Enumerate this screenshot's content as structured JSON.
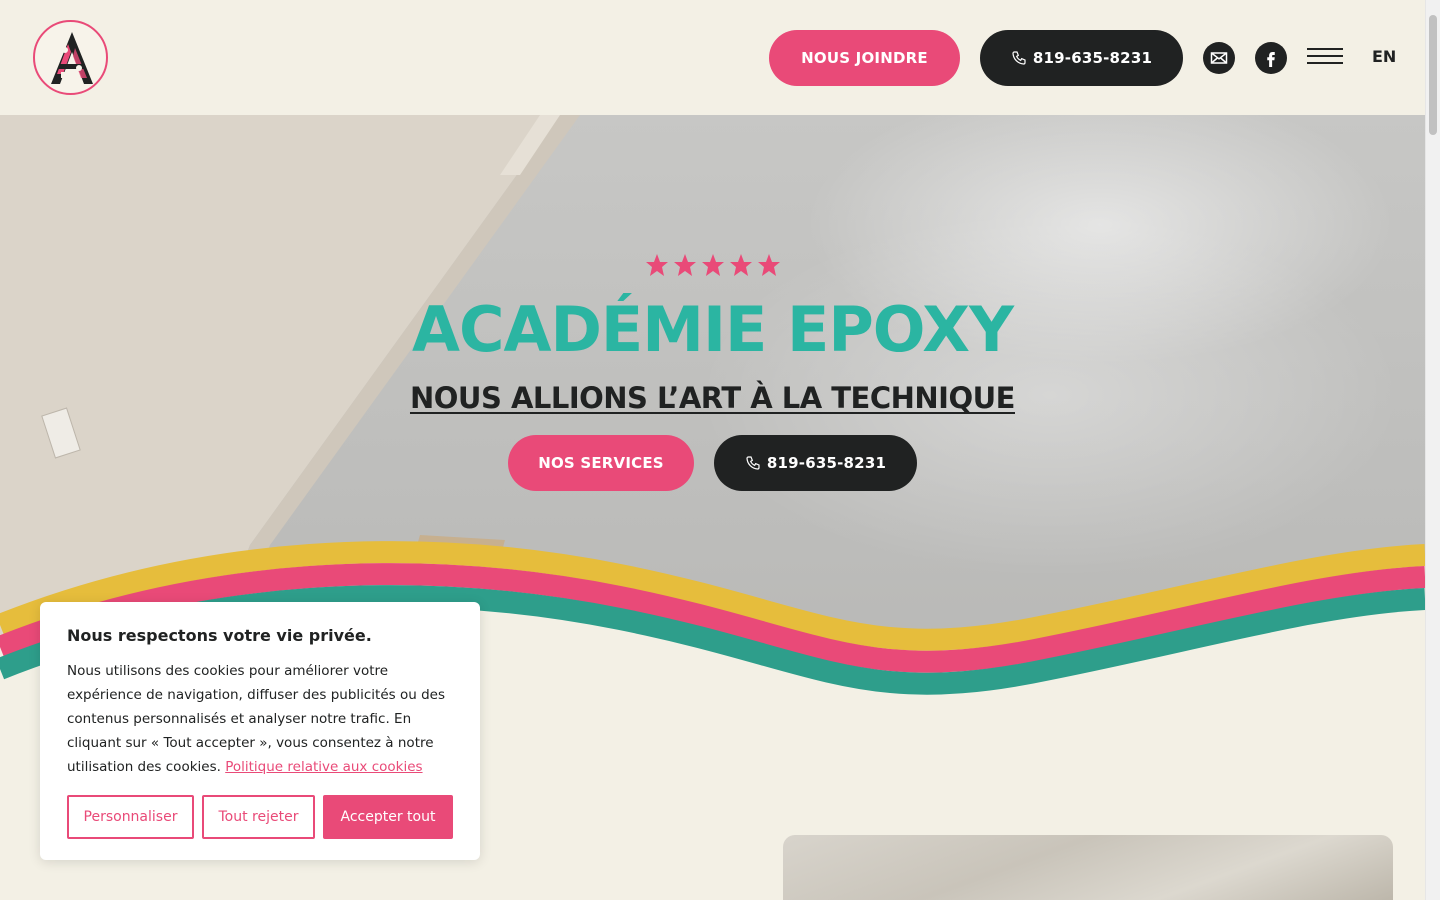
{
  "header": {
    "contact_label": "NOUS JOINDRE",
    "phone_label": "819-635-8231",
    "lang_label": "EN"
  },
  "hero": {
    "rating_stars": 5,
    "title": "ACADÉMIE EPOXY",
    "subtitle": "NOUS ALLIONS L’ART À LA TECHNIQUE",
    "services_label": "NOS SERVICES",
    "phone_label": "819-635-8231"
  },
  "cookie": {
    "title": "Nous respectons votre vie privée.",
    "body": "Nous utilisons des cookies pour améliorer votre expérience de navigation, diffuser des publicités ou des contenus personnalisés et analyser notre trafic. En cliquant sur « Tout accepter », vous consentez à notre utilisation des cookies.",
    "policy_link": "Politique relative aux cookies",
    "customize_label": "Personnaliser",
    "reject_label": "Tout rejeter",
    "accept_label": "Accepter tout"
  },
  "colors": {
    "pink": "#e94a78",
    "teal": "#2bb5a2",
    "yellow": "#e6bd3c",
    "dark": "#202222",
    "cream": "#f3f0e5"
  }
}
